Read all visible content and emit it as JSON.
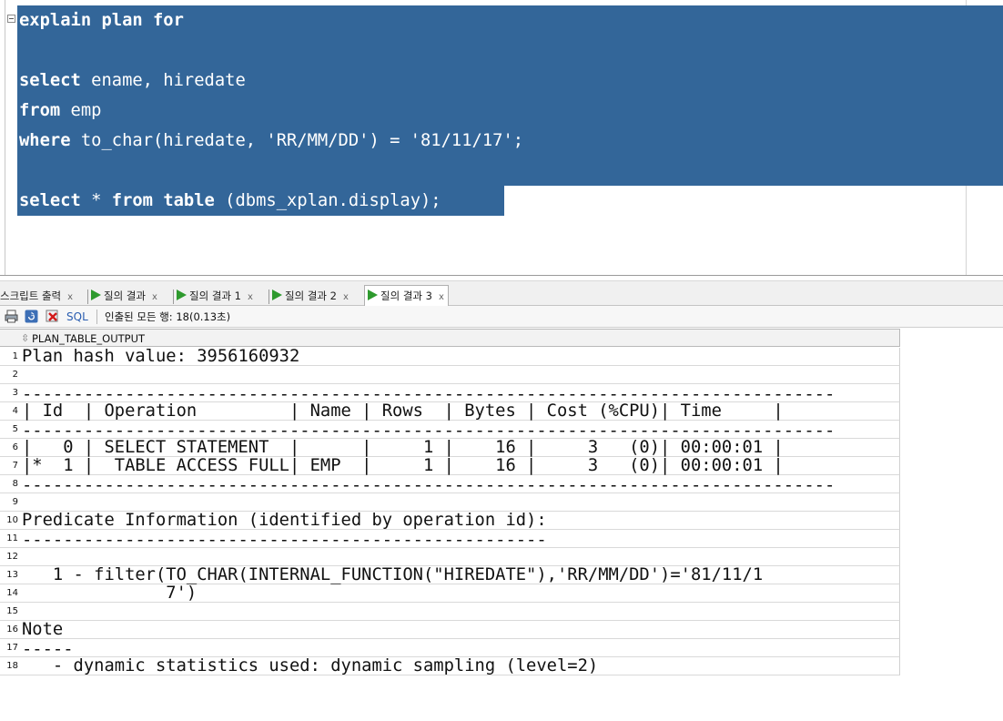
{
  "editor": {
    "lines": [
      [
        {
          "t": "explain plan for",
          "kw": true
        }
      ],
      [],
      [
        {
          "t": "select",
          "kw": true
        },
        {
          "t": " ename, hiredate",
          "kw": false
        }
      ],
      [
        {
          "t": "from",
          "kw": true
        },
        {
          "t": " emp",
          "kw": false
        }
      ],
      [
        {
          "t": "where",
          "kw": true
        },
        {
          "t": " to_char(hiredate, 'RR/MM/DD') = '81/11/17';",
          "kw": false
        }
      ],
      [],
      [
        {
          "t": "select",
          "kw": true
        },
        {
          "t": " * ",
          "kw": false
        },
        {
          "t": "from",
          "kw": true
        },
        {
          "t": " ",
          "kw": false
        },
        {
          "t": "table",
          "kw": true
        },
        {
          "t": " (dbms_xplan.display);",
          "kw": false
        }
      ]
    ],
    "selection_color": "#336699"
  },
  "tabs": [
    {
      "label": "스크립트 출력",
      "close": "x",
      "icon": "none",
      "active": false
    },
    {
      "label": "질의 결과",
      "close": "x",
      "icon": "play-icon",
      "active": false
    },
    {
      "label": "질의 결과 1",
      "close": "x",
      "icon": "play-icon",
      "active": false
    },
    {
      "label": "질의 결과 2",
      "close": "x",
      "icon": "play-icon",
      "active": false
    },
    {
      "label": "질의 결과 3",
      "close": "x",
      "icon": "play-icon",
      "active": true
    }
  ],
  "toolbar": {
    "icons": [
      "print-icon",
      "refresh-icon",
      "delete-icon"
    ],
    "sql_label": "SQL",
    "fetch_status": "인출된 모든 행: 18(0.13초)"
  },
  "grid": {
    "column": "PLAN_TABLE_OUTPUT",
    "sort_icon": "sort-icon",
    "rows": [
      {
        "n": "1",
        "text": "Plan hash value: 3956160932"
      },
      {
        "n": "2",
        "text": ""
      },
      {
        "n": "3",
        "text": "-------------------------------------------------------------------------------"
      },
      {
        "n": "4",
        "text": "| Id  | Operation         | Name | Rows  | Bytes | Cost (%CPU)| Time     |"
      },
      {
        "n": "5",
        "text": "-------------------------------------------------------------------------------"
      },
      {
        "n": "6",
        "text": "|   0 | SELECT STATEMENT  |      |     1 |    16 |     3   (0)| 00:00:01 |"
      },
      {
        "n": "7",
        "text": "|*  1 |  TABLE ACCESS FULL| EMP  |     1 |    16 |     3   (0)| 00:00:01 |"
      },
      {
        "n": "8",
        "text": "-------------------------------------------------------------------------------"
      },
      {
        "n": "9",
        "text": ""
      },
      {
        "n": "10",
        "text": "Predicate Information (identified by operation id):"
      },
      {
        "n": "11",
        "text": "---------------------------------------------------"
      },
      {
        "n": "12",
        "text": ""
      },
      {
        "n": "13",
        "text": "   1 - filter(TO_CHAR(INTERNAL_FUNCTION(\"HIREDATE\"),'RR/MM/DD')='81/11/1"
      },
      {
        "n": "14",
        "text": "              7')"
      },
      {
        "n": "15",
        "text": ""
      },
      {
        "n": "16",
        "text": "Note"
      },
      {
        "n": "17",
        "text": "-----"
      },
      {
        "n": "18",
        "text": "   - dynamic statistics used: dynamic sampling (level=2)"
      }
    ]
  }
}
